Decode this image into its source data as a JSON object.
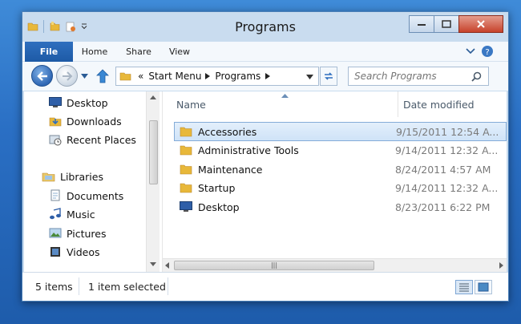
{
  "window": {
    "title": "Programs"
  },
  "ribbon": {
    "tabs": [
      {
        "label": "File"
      },
      {
        "label": "Home"
      },
      {
        "label": "Share"
      },
      {
        "label": "View"
      }
    ]
  },
  "address": {
    "prefix": "«",
    "crumbs": [
      "Start Menu",
      "Programs"
    ]
  },
  "search": {
    "placeholder": "Search Programs"
  },
  "nav_pane": {
    "favorites": [
      {
        "label": "Desktop",
        "icon": "desktop-icon"
      },
      {
        "label": "Downloads",
        "icon": "downloads-folder-icon"
      },
      {
        "label": "Recent Places",
        "icon": "recent-places-icon"
      }
    ],
    "libraries_label": "Libraries",
    "libraries": [
      {
        "label": "Documents",
        "icon": "documents-icon"
      },
      {
        "label": "Music",
        "icon": "music-icon"
      },
      {
        "label": "Pictures",
        "icon": "pictures-icon"
      },
      {
        "label": "Videos",
        "icon": "videos-icon"
      }
    ]
  },
  "file_list": {
    "columns": {
      "name": "Name",
      "date": "Date modified"
    },
    "rows": [
      {
        "name": "Accessories",
        "date": "9/15/2011 12:54 A...",
        "icon": "folder-icon",
        "selected": true
      },
      {
        "name": "Administrative Tools",
        "date": "9/14/2011 12:32 A...",
        "icon": "folder-icon",
        "selected": false
      },
      {
        "name": "Maintenance",
        "date": "8/24/2011 4:57 AM",
        "icon": "folder-icon",
        "selected": false
      },
      {
        "name": "Startup",
        "date": "9/14/2011 12:32 A...",
        "icon": "folder-icon",
        "selected": false
      },
      {
        "name": "Desktop",
        "date": "8/23/2011 6:22 PM",
        "icon": "desktop-shortcut-icon",
        "selected": false
      }
    ]
  },
  "status_bar": {
    "item_count": "5 items",
    "selection": "1 item selected"
  },
  "colors": {
    "accent": "#2f6fbf",
    "selection_bg": "#cfe3f8",
    "folder": "#e8b83a"
  }
}
